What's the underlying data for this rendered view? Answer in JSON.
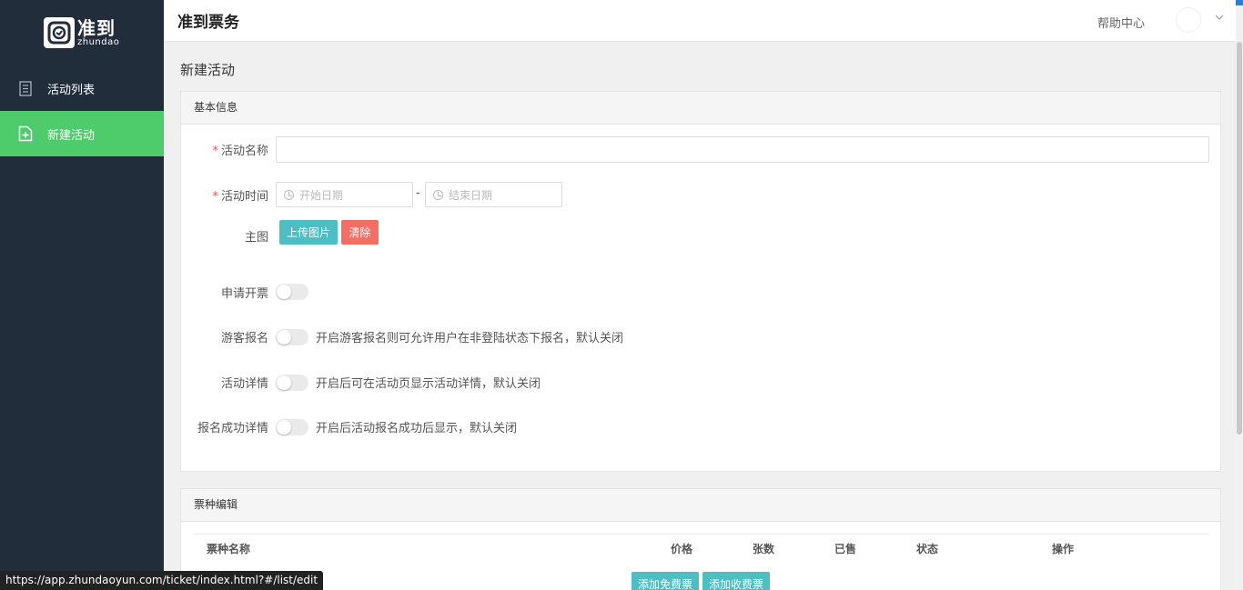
{
  "sidebar": {
    "logo": {
      "cn": "准到",
      "en": "zhundao"
    },
    "items": [
      {
        "label": "活动列表",
        "icon": "document-icon",
        "active": false
      },
      {
        "label": "新建活动",
        "icon": "add-file-icon",
        "active": true
      }
    ]
  },
  "header": {
    "title": "准到票务",
    "help": "帮助中心"
  },
  "page": {
    "title": "新建活动"
  },
  "basic_info": {
    "heading": "基本信息",
    "name_label": "活动名称",
    "name_value": "",
    "time_label": "活动时间",
    "start_placeholder": "开始日期",
    "end_placeholder": "结束日期",
    "range_separator": "-",
    "image_label": "主图",
    "upload_button": "上传图片",
    "clear_button": "清除",
    "invoice_label": "申请开票",
    "guest_label": "游客报名",
    "guest_hint": "开启游客报名则可允许用户在非登陆状态下报名，默认关闭",
    "detail_label": "活动详情",
    "detail_hint": "开启后可在活动页显示活动详情，默认关闭",
    "success_label": "报名成功详情",
    "success_hint": "开启后活动报名成功后显示，默认关闭"
  },
  "ticket_edit": {
    "heading": "票种编辑",
    "columns": [
      "票种名称",
      "价格",
      "张数",
      "已售",
      "状态",
      "操作"
    ],
    "add_free_button": "添加免费票",
    "add_paid_button": "添加收费票"
  },
  "statusbar": {
    "url": "https://app.zhundaoyun.com/ticket/index.html?#/list/edit"
  },
  "colors": {
    "sidebar_bg": "#222d3c",
    "active_green": "#4ecb6b",
    "teal": "#4cbfc4",
    "red": "#f46e63"
  }
}
